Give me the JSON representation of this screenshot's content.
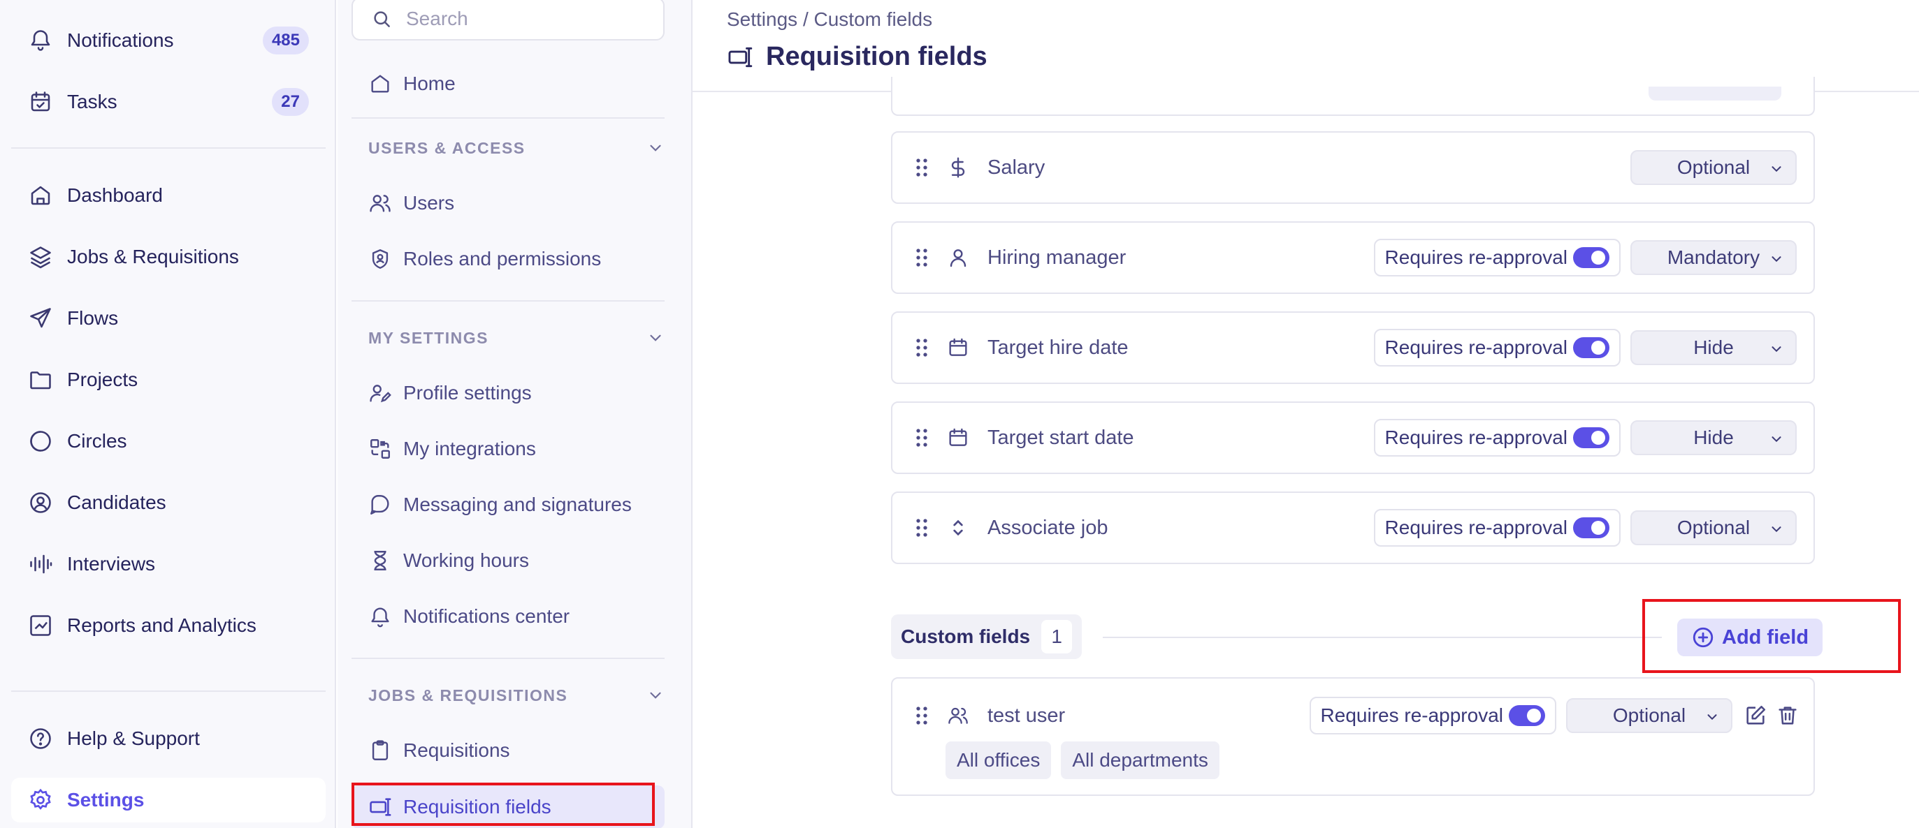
{
  "nav": {
    "notifications": {
      "label": "Notifications",
      "count": "485"
    },
    "tasks": {
      "label": "Tasks",
      "count": "27"
    },
    "items": [
      {
        "label": "Dashboard"
      },
      {
        "label": "Jobs & Requisitions"
      },
      {
        "label": "Flows"
      },
      {
        "label": "Projects"
      },
      {
        "label": "Circles"
      },
      {
        "label": "Candidates"
      },
      {
        "label": "Interviews"
      },
      {
        "label": "Reports and Analytics"
      }
    ],
    "help": "Help & Support",
    "settings": "Settings"
  },
  "menu": {
    "search_placeholder": "Search",
    "home": "Home",
    "sections": [
      {
        "title": "USERS & ACCESS",
        "items": [
          "Users",
          "Roles and permissions"
        ]
      },
      {
        "title": "MY SETTINGS",
        "items": [
          "Profile settings",
          "My integrations",
          "Messaging and signatures",
          "Working hours",
          "Notifications center"
        ]
      },
      {
        "title": "JOBS & REQUISITIONS",
        "items": [
          "Requisitions",
          "Requisition fields"
        ]
      }
    ]
  },
  "header": {
    "breadcrumb": "Settings / Custom fields",
    "title": "Requisition fields"
  },
  "fields": [
    {
      "name": "Salary",
      "icon": "dollar-icon",
      "reapproval": "",
      "visibility": "Optional"
    },
    {
      "name": "Hiring manager",
      "icon": "person-icon",
      "reapproval": "Requires re-approval",
      "visibility": "Mandatory"
    },
    {
      "name": "Target hire date",
      "icon": "calendar-icon",
      "reapproval": "Requires re-approval",
      "visibility": "Hide"
    },
    {
      "name": "Target start date",
      "icon": "calendar-icon",
      "reapproval": "Requires re-approval",
      "visibility": "Hide"
    },
    {
      "name": "Associate job",
      "icon": "chevron-up-down-icon",
      "reapproval": "Requires re-approval",
      "visibility": "Optional"
    }
  ],
  "custom": {
    "label": "Custom fields",
    "count": "1",
    "add_label": "Add field",
    "fields": [
      {
        "name": "test user",
        "reapproval": "Requires re-approval",
        "visibility": "Optional",
        "tags": [
          "All offices",
          "All departments"
        ]
      }
    ]
  },
  "colors": {
    "accent": "#5b50e6",
    "highlight": "#e8141c",
    "text": "#2f2c6e"
  }
}
